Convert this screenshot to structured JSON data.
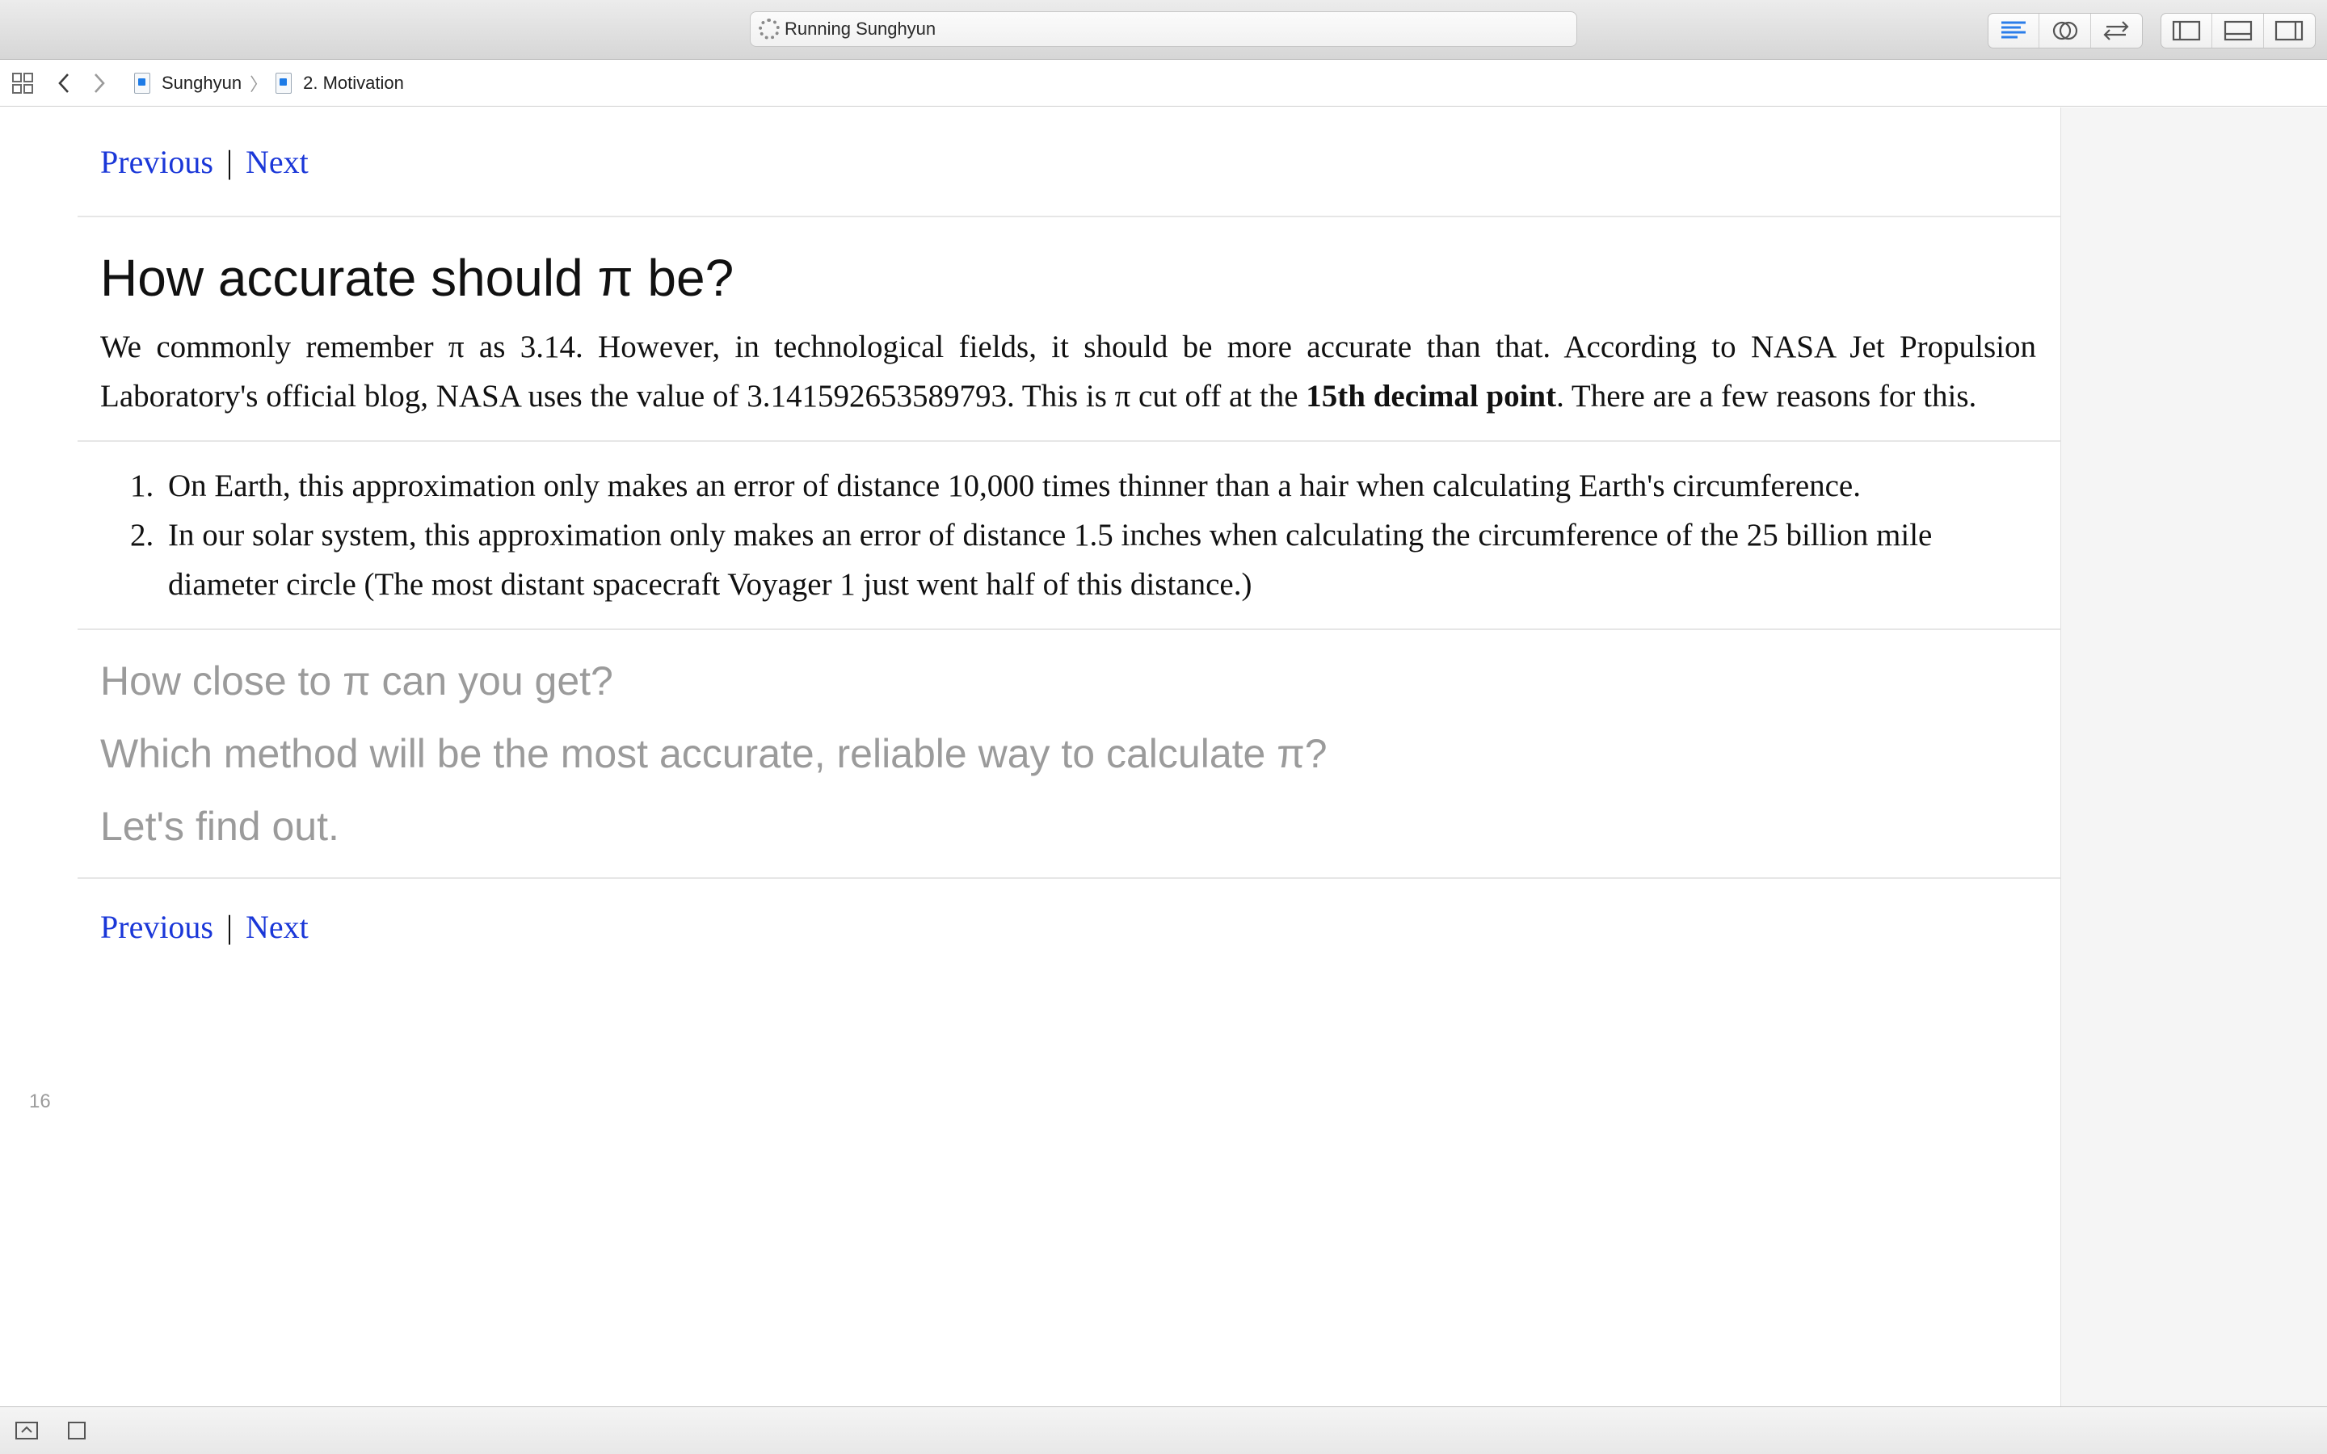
{
  "toolbar": {
    "activity_text": "Running Sunghyun"
  },
  "jumpbar": {
    "crumbs": [
      "Sunghyun",
      "2. Motivation"
    ]
  },
  "nav": {
    "previous": "Previous",
    "separator": "|",
    "next": "Next"
  },
  "content": {
    "title": "How accurate should π be?",
    "para_before_bold": "We commonly remember π as 3.14. However, in technological fields, it should be more accurate than that. According to NASA Jet Propulsion Laboratory's official blog, NASA uses the value of 3.141592653589793. This is π cut off at the ",
    "para_bold": "15th decimal point",
    "para_after_bold": ". There are a few reasons for this.",
    "list": [
      "On Earth, this approximation only makes an error of distance 10,000 times thinner than a hair when calculating Earth's circumference.",
      "In our solar system, this approximation only makes an error of distance 1.5 inches when calculating the circumference of the 25 billion mile diameter circle (The most distant spacecraft Voyager 1 just went half of this distance.)"
    ],
    "questions": [
      "How close to π can you get?",
      "Which method will be the most accurate, reliable way to calculate π?",
      "Let's find out."
    ]
  },
  "editor": {
    "line_number": "16"
  },
  "colors": {
    "link": "#1a37d8",
    "accent_blue": "#1e7be6",
    "muted_text": "#9b9b9b"
  }
}
